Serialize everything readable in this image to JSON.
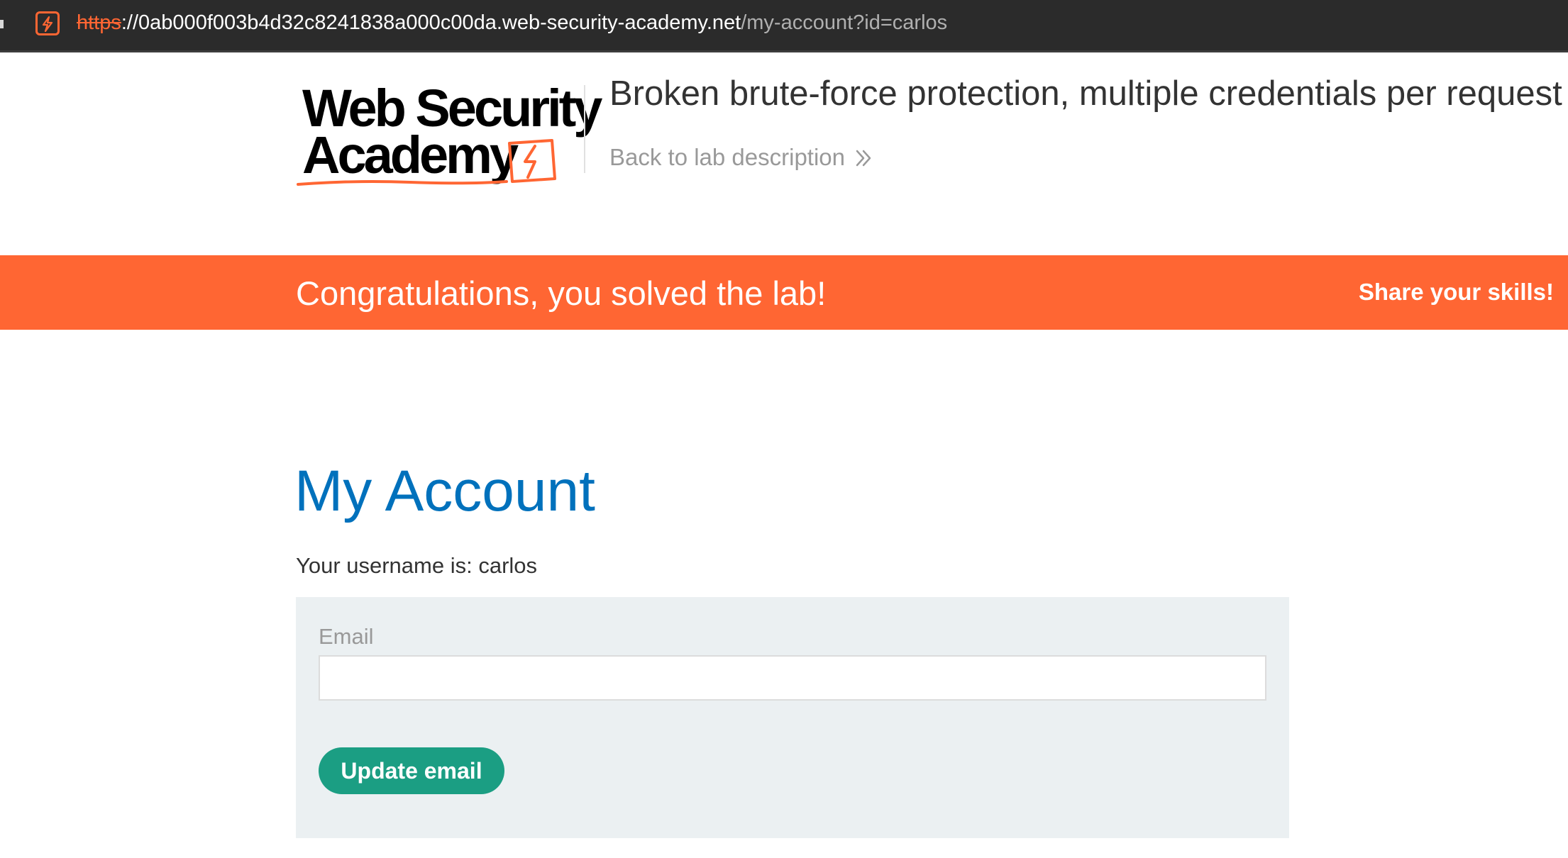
{
  "browser": {
    "url_scheme": "https",
    "url_separator": "://",
    "url_host": "0ab000f003b4d32c8241838a000c00da.web-security-academy.net",
    "url_path": "/my-account?id=carlos",
    "site_icon": "lightning-square-icon"
  },
  "header": {
    "logo_line1": "Web Security",
    "logo_line2": "Academy",
    "lab_title": "Broken brute-force protection, multiple credentials per request",
    "back_link": "Back to lab description",
    "back_icon": "double-chevron-right-icon"
  },
  "banner": {
    "message": "Congratulations, you solved the lab!",
    "share": "Share your skills!",
    "color": "#ff6633"
  },
  "main": {
    "title": "My Account",
    "username_line": "Your username is: carlos",
    "email_label": "Email",
    "email_value": "",
    "update_button": "Update email",
    "title_color": "#0071bc",
    "button_color": "#1b9e83"
  }
}
